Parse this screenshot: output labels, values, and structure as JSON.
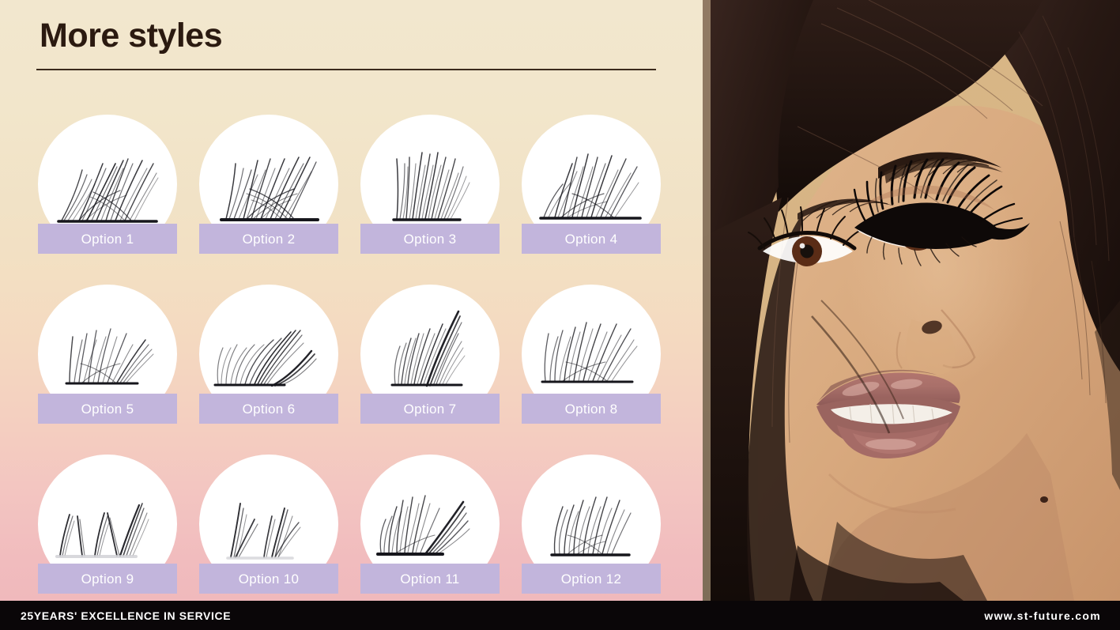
{
  "slide": {
    "title": "More styles",
    "background_top_color": "#f2e7ce",
    "background_bottom_color": "#f0b9bc",
    "title_color": "#2b1a10",
    "label_band_color": "#c2b5dc",
    "footer_bg_color": "#0a0608"
  },
  "options": [
    {
      "label": "Option 1",
      "art": "fan-dense-wide"
    },
    {
      "label": "Option 2",
      "art": "fan-crisscross"
    },
    {
      "label": "Option 3",
      "art": "fan-tall-narrow"
    },
    {
      "label": "Option 4",
      "art": "fan-spiky-wide"
    },
    {
      "label": "Option 5",
      "art": "fan-open-light"
    },
    {
      "label": "Option 6",
      "art": "diagonal-right-low"
    },
    {
      "label": "Option 7",
      "art": "diagonal-right-steep"
    },
    {
      "label": "Option 8",
      "art": "fan-wispy-wide"
    },
    {
      "label": "Option 9",
      "art": "spike-cluster-m"
    },
    {
      "label": "Option 10",
      "art": "spike-cluster-v"
    },
    {
      "label": "Option 11",
      "art": "fan-swept-right"
    },
    {
      "label": "Option 12",
      "art": "fan-curl-even"
    }
  ],
  "photo": {
    "alt": "close-up portrait of woman with dark hair wearing eyelash extensions",
    "background_color": "#d8b686",
    "skin_color": "#d6a879",
    "hair_color": "#2a1a15",
    "lip_color": "#a8706b"
  },
  "footer": {
    "left_text": "25YEARS' EXCELLENCE IN SERVICE",
    "right_text": "www.st-future.com"
  }
}
